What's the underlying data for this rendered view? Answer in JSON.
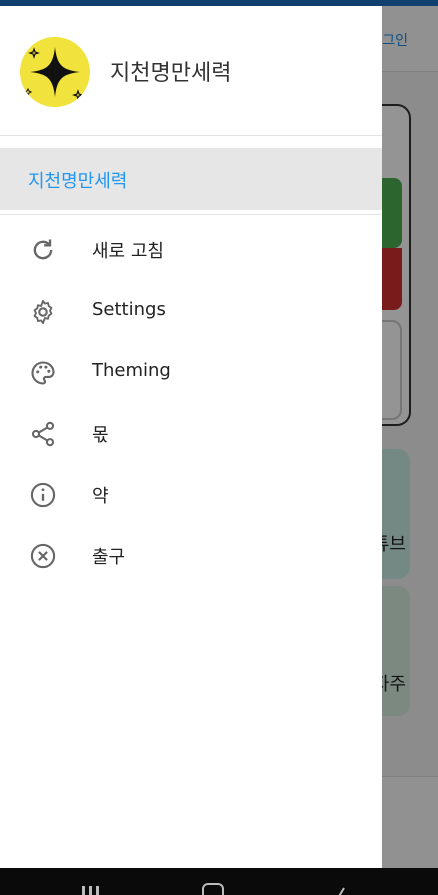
{
  "background": {
    "login_text": "그인",
    "tile1_text": "튜브",
    "tile2_text": "자주"
  },
  "drawer": {
    "title": "지천명만세력",
    "selected_item": "지천명만세력",
    "items": [
      {
        "label": "새로 고침",
        "icon": "refresh-icon"
      },
      {
        "label": "Settings",
        "icon": "gear-icon"
      },
      {
        "label": "Theming",
        "icon": "palette-icon"
      },
      {
        "label": "몫",
        "icon": "share-icon"
      },
      {
        "label": "약",
        "icon": "info-icon"
      },
      {
        "label": "출구",
        "icon": "close-circle-icon"
      }
    ]
  },
  "colors": {
    "accent": "#2196f3",
    "avatar_bg": "#f2e33c",
    "status_bar": "#1e6fbf"
  }
}
